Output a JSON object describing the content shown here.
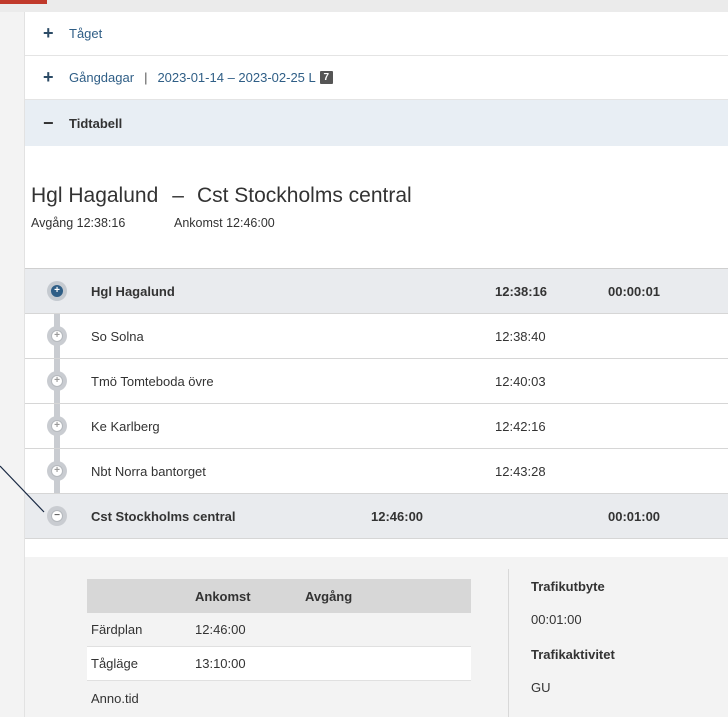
{
  "sections": {
    "taget": {
      "label": "Tåget"
    },
    "gangdagar": {
      "label": "Gångdagar",
      "separator": "|",
      "range": "2023-01-14 – 2023-02-25 L",
      "badge": "7"
    },
    "tidtabell": {
      "label": "Tidtabell"
    }
  },
  "route": {
    "from": "Hgl Hagalund",
    "dash": "–",
    "to": "Cst Stockholms central",
    "departure": "Avgång 12:38:16",
    "arrival": "Ankomst 12:46:00"
  },
  "stops": [
    {
      "name": "Hgl Hagalund",
      "time": "12:38:16",
      "extra": "00:00:01"
    },
    {
      "name": "So Solna",
      "time": "12:38:40",
      "extra": ""
    },
    {
      "name": "Tmö Tomteboda övre",
      "time": "12:40:03",
      "extra": ""
    },
    {
      "name": "Ke Karlberg",
      "time": "12:42:16",
      "extra": ""
    },
    {
      "name": "Nbt Norra bantorget",
      "time": "12:43:28",
      "extra": ""
    },
    {
      "name": "Cst Stockholms central",
      "time": "12:46:00",
      "extra": "00:01:00"
    }
  ],
  "details": {
    "headers": [
      "",
      "Ankomst",
      "Avgång"
    ],
    "rows": [
      {
        "label": "Färdplan",
        "arr": "12:46:00",
        "dep": ""
      },
      {
        "label": "Tågläge",
        "arr": "13:10:00",
        "dep": ""
      },
      {
        "label": "Anno.tid",
        "arr": "",
        "dep": ""
      }
    ],
    "trafikutbyte_label": "Trafikutbyte",
    "trafikutbyte_value": "00:01:00",
    "trafikaktivitet_label": "Trafikaktivitet",
    "trafikaktivitet_value": "GU"
  },
  "icons": {
    "expand": "plus-icon",
    "collapse": "minus-icon",
    "stop_node": "circle-plus-icon"
  },
  "colors": {
    "accent": "#2f5e86",
    "selected_section": "#e8eef4",
    "callout": "#c0392b"
  }
}
